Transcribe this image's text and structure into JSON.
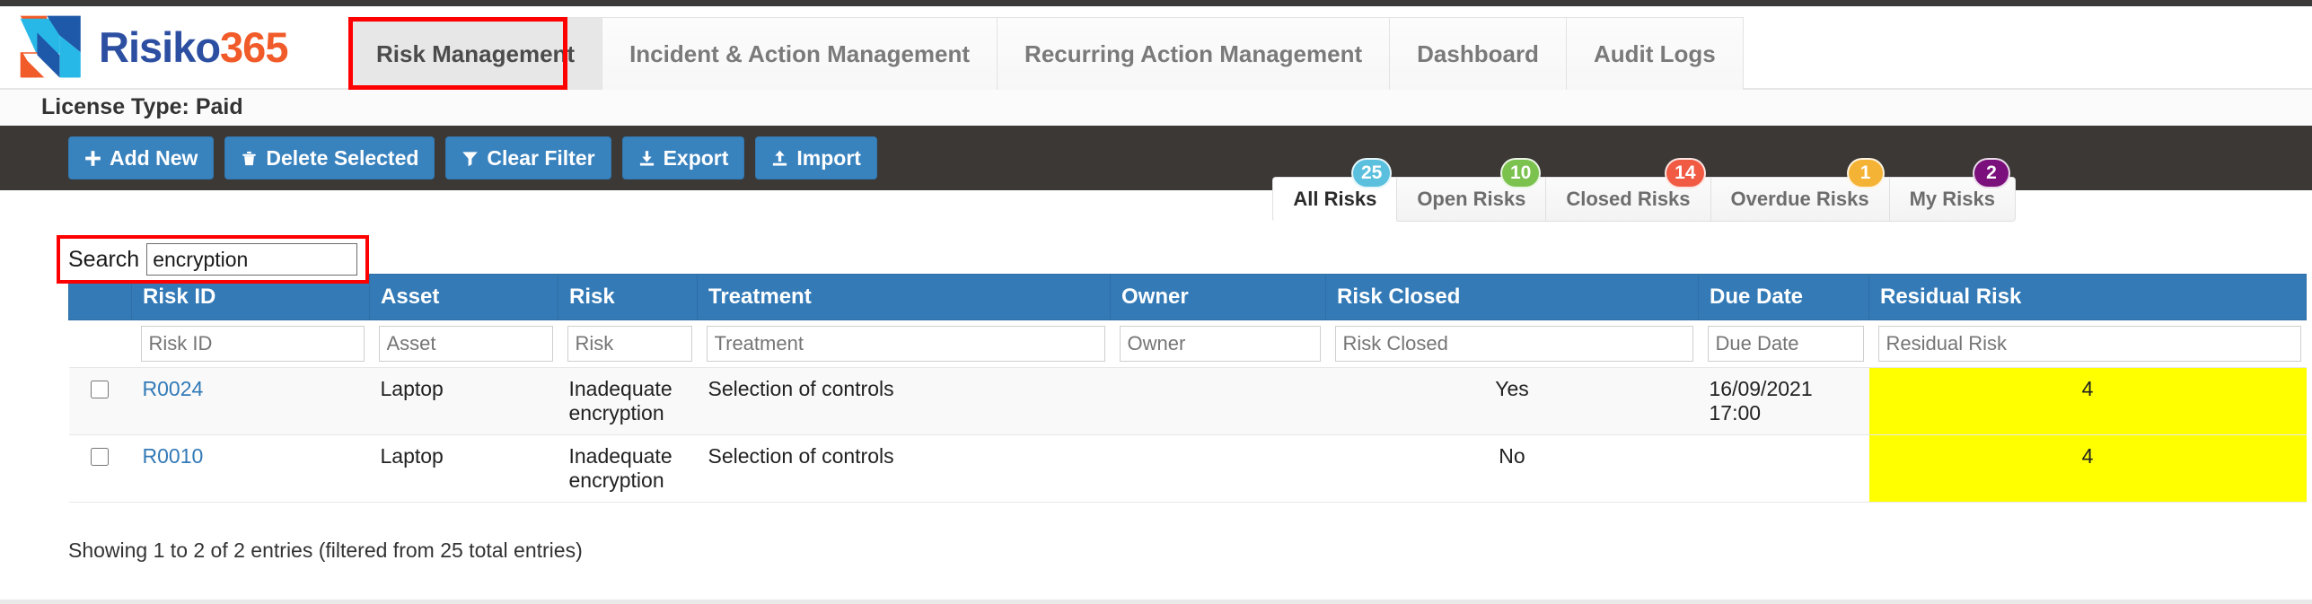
{
  "brand": {
    "name_part1": "Risiko",
    "name_part2": "365",
    "logo_icon": "risiko-arrow-logo"
  },
  "nav": {
    "tabs": [
      {
        "label": "Risk Management",
        "active": true,
        "highlighted": true
      },
      {
        "label": "Incident & Action Management",
        "active": false
      },
      {
        "label": "Recurring Action Management",
        "active": false
      },
      {
        "label": "Dashboard",
        "active": false
      },
      {
        "label": "Audit Logs",
        "active": false
      }
    ]
  },
  "license": {
    "text": "License Type: Paid"
  },
  "toolbar": {
    "buttons": [
      {
        "label": "Add New",
        "icon": "plus-icon"
      },
      {
        "label": "Delete Selected",
        "icon": "trash-icon"
      },
      {
        "label": "Clear Filter",
        "icon": "funnel-icon"
      },
      {
        "label": "Export",
        "icon": "download-icon"
      },
      {
        "label": "Import",
        "icon": "upload-icon"
      }
    ],
    "button_color": "#3882be",
    "bar_color": "#3b3836"
  },
  "risk_filters": [
    {
      "label": "All Risks",
      "count": "25",
      "color": "#5bc0de",
      "active": true
    },
    {
      "label": "Open Risks",
      "count": "10",
      "color": "#7cc24f",
      "active": false
    },
    {
      "label": "Closed Risks",
      "count": "14",
      "color": "#f15b43",
      "active": false
    },
    {
      "label": "Overdue Risks",
      "count": "1",
      "color": "#f5b335",
      "active": false
    },
    {
      "label": "My Risks",
      "count": "2",
      "color": "#7b0f7b",
      "active": false
    }
  ],
  "search": {
    "label": "Search",
    "value": "encryption",
    "placeholder": "",
    "highlight_color": "#ff0000"
  },
  "table": {
    "headers": [
      "",
      "Risk ID",
      "Asset",
      "Risk",
      "Treatment",
      "Owner",
      "Risk Closed",
      "Due Date",
      "Residual Risk"
    ],
    "header_color": "#337ab7",
    "filter_placeholders": [
      "",
      "Risk ID",
      "Asset",
      "Risk",
      "Treatment",
      "Owner",
      "Risk Closed",
      "Due Date",
      "Residual Risk"
    ],
    "rows": [
      {
        "risk_id": "R0024",
        "asset": "Laptop",
        "risk": "Inadequate encryption",
        "treatment": "Selection of controls",
        "owner": "",
        "risk_closed": "Yes",
        "due_date": "16/09/2021 17:00",
        "residual_risk": "4"
      },
      {
        "risk_id": "R0010",
        "asset": "Laptop",
        "risk": "Inadequate encryption",
        "treatment": "Selection of controls",
        "owner": "",
        "risk_closed": "No",
        "due_date": "",
        "residual_risk": "4"
      }
    ],
    "residual_cell_color": "#ffff00"
  },
  "footer": {
    "info": "Showing 1 to 2 of 2 entries (filtered from 25 total entries)"
  }
}
